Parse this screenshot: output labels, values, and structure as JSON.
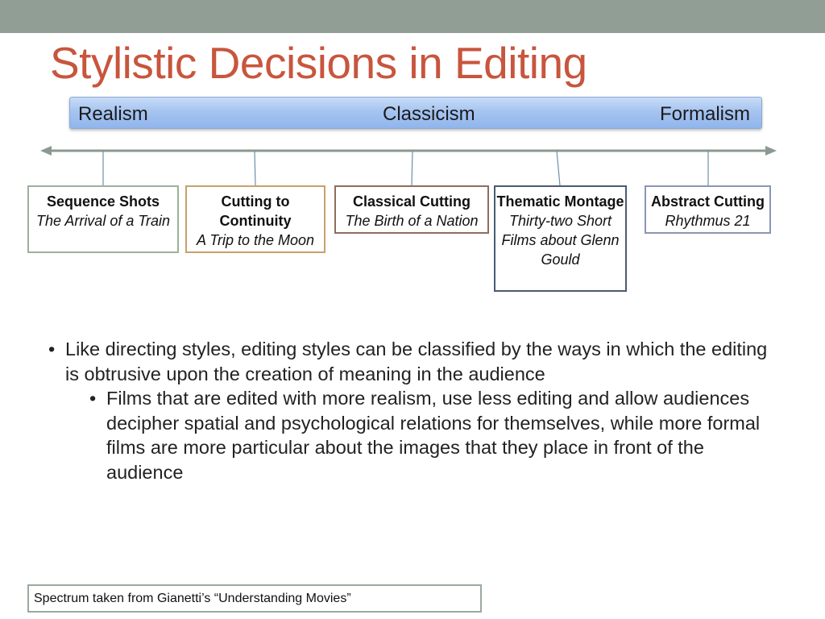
{
  "slide": {
    "title": "Stylistic Decisions in Editing",
    "spectrum": {
      "left_label": "Realism",
      "center_label": "Classicism",
      "right_label": "Formalism"
    },
    "boxes": [
      {
        "heading": "Sequence Shots",
        "film": "The Arrival of a Train"
      },
      {
        "heading": "Cutting to Continuity",
        "film": "A Trip to the Moon"
      },
      {
        "heading": "Classical Cutting",
        "film": "The Birth of a Nation"
      },
      {
        "heading": "Thematic Montage",
        "film": "Thirty-two Short Films about Glenn Gould"
      },
      {
        "heading": "Abstract Cutting",
        "film": "Rhythmus 21"
      }
    ],
    "bullets": {
      "main": "Like directing styles, editing styles can be classified by the ways in which the editing is obtrusive upon the creation of meaning in the audience",
      "sub": "Films that are edited with more realism, use less editing and allow audiences decipher spatial and psychological relations for themselves, while more formal films are more particular about the images that they place in front of the audience"
    },
    "source_note": "Spectrum taken from Gianetti’s “Understanding Movies”"
  },
  "colors": {
    "title": "#c8553d",
    "top_bar": "#909e96",
    "spectrum_fill": "#a6c4f0",
    "arrow": "#8a9a90"
  }
}
